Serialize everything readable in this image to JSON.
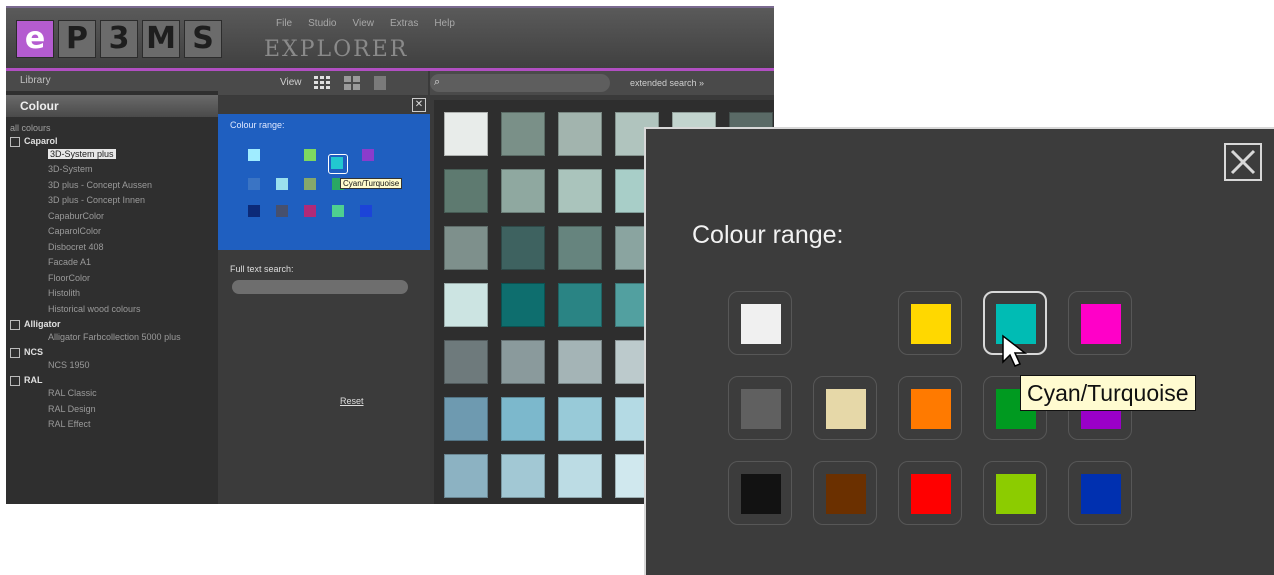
{
  "logo": {
    "letters": [
      "e",
      "P",
      "3",
      "M",
      "S"
    ]
  },
  "menu": [
    "File",
    "Studio",
    "View",
    "Extras",
    "Help"
  ],
  "app_title": "EXPLORER",
  "left_panel": {
    "library_label": "Library",
    "section_title": "Colour",
    "tree": {
      "root_label": "all colours",
      "groups": [
        {
          "label": "Caparol",
          "children": [
            "3D-System plus",
            "3D-System",
            "3D plus - Concept Aussen",
            "3D plus - Concept Innen",
            "CapaburColor",
            "CaparolColor",
            "Disbocret 408",
            "Facade A1",
            "FloorColor",
            "Histolith",
            "Historical wood colours"
          ],
          "selected_index": 0
        },
        {
          "label": "Alligator",
          "children": [
            "Alligator Farbcollection 5000 plus"
          ],
          "selected_index": -1
        },
        {
          "label": "NCS",
          "children": [
            "NCS 1950"
          ],
          "selected_index": -1
        },
        {
          "label": "RAL",
          "children": [
            "RAL Classic",
            "RAL Design",
            "RAL Effect"
          ],
          "selected_index": -1
        }
      ]
    }
  },
  "toolbar": {
    "view_label": "View"
  },
  "filter_panel": {
    "close_label": "✕",
    "colour_range_label": "Colour range:",
    "tooltip": "Cyan/Turquoise",
    "fulltext_label": "Full text search:",
    "reset_label": "Reset"
  },
  "search": {
    "placeholder": "",
    "extended_label": "extended search  »"
  },
  "zoom": {
    "title": "Colour range:",
    "tooltip": "Cyan/Turquoise",
    "swatches": [
      {
        "name": "White",
        "color": "#f0f0f0"
      },
      {
        "name": "Yellow",
        "color": "#ffd800"
      },
      {
        "name": "Cyan/Turquoise",
        "color": "#00bcb4",
        "selected": true
      },
      {
        "name": "Magenta",
        "color": "#ff00c8"
      },
      {
        "name": "Grey",
        "color": "#606060"
      },
      {
        "name": "Beige",
        "color": "#e6d8a8"
      },
      {
        "name": "Orange",
        "color": "#ff7a00"
      },
      {
        "name": "Green",
        "color": "#009a20"
      },
      {
        "name": "Violet",
        "color": "#9a00c8"
      },
      {
        "name": "Black",
        "color": "#121212"
      },
      {
        "name": "Brown",
        "color": "#6b3000"
      },
      {
        "name": "Red",
        "color": "#ff0000"
      },
      {
        "name": "Lime",
        "color": "#8ccc00"
      },
      {
        "name": "Blue",
        "color": "#0030b0"
      }
    ]
  },
  "grid_colors": [
    [
      "#e8ecea",
      "#7a9088",
      "#a2b4ae",
      "#b0c4be",
      "#c2d4ce",
      "#5a6a66"
    ],
    [
      "#5e7a70",
      "#8fa8a0",
      "#aac4bc",
      "#a8cec8",
      "#b4d6d0",
      "#4c6a64"
    ],
    [
      "#7e908c",
      "#3e6260",
      "#66847e",
      "#8aa4a0",
      "#a2bcb8",
      "#5c7c78"
    ],
    [
      "#cce4e2",
      "#0e6e6e",
      "#2a8484",
      "#52a0a0",
      "#88c0c0",
      "#3c7c7c"
    ],
    [
      "#6e7a7c",
      "#8a9a9c",
      "#a4b4b6",
      "#bccacc",
      "#ccd8da",
      "#808e90"
    ],
    [
      "#6e9ab0",
      "#7cb8cc",
      "#98cad8",
      "#b4dae4",
      "#cce8ee",
      "#5e8ca0"
    ],
    [
      "#8cb2c2",
      "#a2c8d4",
      "#bcdce4",
      "#d0e8ee",
      "#dcf0f4",
      "#78a2b4"
    ]
  ]
}
